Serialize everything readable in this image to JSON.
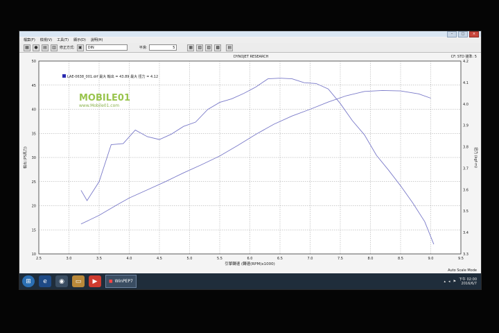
{
  "window": {
    "controls": [
      "–",
      "□",
      "×"
    ]
  },
  "menu": {
    "items": [
      "檔案(F)",
      "檢視(V)",
      "工具(T)",
      "顯示(D)",
      "說明(H)"
    ]
  },
  "toolbar": {
    "label_correction": "修正方式:",
    "correction_value": "DIN",
    "label_smoothing": "平滑:",
    "smoothing_value": "5"
  },
  "chart_header": {
    "title": "DYNOJET RESEARCH",
    "right_text": "CF: STD  描準: 5"
  },
  "watermark": {
    "brand": "MOBILE01",
    "url": "www.Mobile01.com"
  },
  "chart_data": {
    "type": "line",
    "title": "DYNOJET RESEARCH",
    "xlabel": "引擎轉速 (轉速(RPM)x1000)",
    "ylabel": "輸出 (PS馬力)",
    "y2label": "扭力 (kgf·m)",
    "xlim": [
      2.5,
      9.5
    ],
    "ylim": [
      10,
      50
    ],
    "y2lim": [
      3.3,
      4.2
    ],
    "x_ticks": [
      "2.5",
      "3.0",
      "3.5",
      "4.0",
      "4.5",
      "5.0",
      "5.5",
      "6.0",
      "6.5",
      "7.0",
      "7.5",
      "8.0",
      "8.5",
      "9.0",
      "9.5"
    ],
    "y_ticks": [
      "10",
      "15",
      "20",
      "25",
      "30",
      "35",
      "40",
      "45",
      "50"
    ],
    "y2_ticks": [
      "3.3",
      "3.4",
      "3.5",
      "3.6",
      "3.7",
      "3.8",
      "3.9",
      "4.0",
      "4.1",
      "4.2"
    ],
    "legend": "LAE-0638_001.drf 最大 輸出 = 43.89 最大 扭力 = 4.12",
    "legend_position": "top-left",
    "grid": true,
    "series": [
      {
        "name": "輸出",
        "axis": "left",
        "color": "#7878c8",
        "x": [
          3.2,
          3.5,
          3.8,
          4.0,
          4.3,
          4.6,
          4.9,
          5.2,
          5.5,
          5.8,
          6.1,
          6.4,
          6.7,
          7.0,
          7.3,
          7.6,
          7.9,
          8.2,
          8.5,
          8.8,
          9.0
        ],
        "y": [
          16.2,
          18.0,
          20.2,
          21.6,
          23.3,
          25.0,
          26.8,
          28.5,
          30.3,
          32.5,
          34.8,
          36.9,
          38.6,
          40.0,
          41.5,
          42.8,
          43.7,
          43.9,
          43.8,
          43.2,
          42.3
        ]
      },
      {
        "name": "扭力",
        "axis": "right",
        "color": "#7878c8",
        "x": [
          3.2,
          3.3,
          3.5,
          3.7,
          3.9,
          4.1,
          4.3,
          4.5,
          4.7,
          4.9,
          5.1,
          5.3,
          5.5,
          5.7,
          5.9,
          6.1,
          6.3,
          6.5,
          6.7,
          6.9,
          7.1,
          7.3,
          7.5,
          7.7,
          7.9,
          8.1,
          8.3,
          8.5,
          8.7,
          8.9,
          9.05
        ],
        "y": [
          3.597,
          3.549,
          3.637,
          3.81,
          3.815,
          3.878,
          3.847,
          3.834,
          3.859,
          3.895,
          3.915,
          3.974,
          4.007,
          4.024,
          4.049,
          4.079,
          4.117,
          4.12,
          4.117,
          4.099,
          4.095,
          4.07,
          4.002,
          3.922,
          3.856,
          3.76,
          3.691,
          3.618,
          3.539,
          3.451,
          3.345
        ]
      }
    ]
  },
  "status": {
    "scale_mode": "Auto Scale Mode"
  },
  "taskbar": {
    "app_label": "WinPEP7",
    "clock_time": "下午 02:00",
    "clock_date": "2016/6/7"
  }
}
